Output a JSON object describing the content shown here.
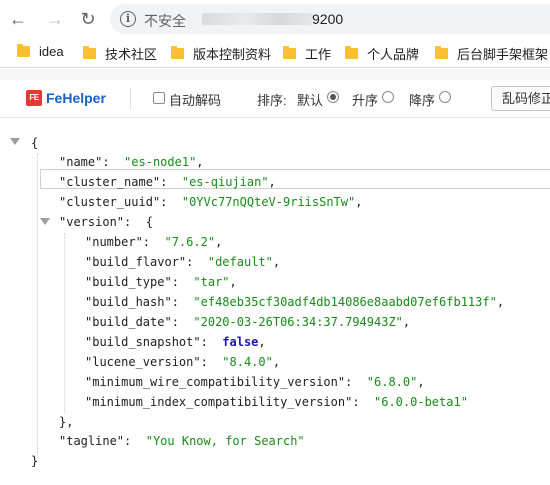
{
  "browser": {
    "back_icon": "back-arrow-icon",
    "forward_icon": "forward-arrow-icon",
    "reload_icon": "reload-icon",
    "security_label": "不安全",
    "url_visible_suffix": "9200"
  },
  "bookmarks": [
    {
      "label": "idea",
      "icon": "folder-icon"
    },
    {
      "label": "技术社区",
      "icon": "folder-icon"
    },
    {
      "label": "版本控制资料",
      "icon": "folder-icon"
    },
    {
      "label": "工作",
      "icon": "folder-icon"
    },
    {
      "label": "个人品牌",
      "icon": "folder-icon"
    },
    {
      "label": "后台脚手架框架",
      "icon": "folder-icon"
    }
  ],
  "fehelper": {
    "logo_mark": "FE",
    "logo_text": "FeHelper",
    "auto_decode_label": "自动解码",
    "auto_decode_checked": false,
    "sort_label": "排序:",
    "sort_options": [
      {
        "label": "默认",
        "selected": true
      },
      {
        "label": "升序",
        "selected": false
      },
      {
        "label": "降序",
        "selected": false
      }
    ],
    "fix_button_label": "乱码修正"
  },
  "json": {
    "open_brace": "{",
    "close_brace": "}",
    "entries": {
      "name": {
        "key": "\"name\"",
        "value": "\"es-node1\""
      },
      "cluster_name": {
        "key": "\"cluster_name\"",
        "value": "\"es-qiujian\""
      },
      "cluster_uuid": {
        "key": "\"cluster_uuid\"",
        "value": "\"0YVc77nQQteV-9riisSnTw\""
      },
      "version": {
        "key": "\"version\"",
        "open": "{",
        "close": "},",
        "fields": [
          {
            "key": "\"number\"",
            "value": "\"7.6.2\"",
            "type": "string"
          },
          {
            "key": "\"build_flavor\"",
            "value": "\"default\"",
            "type": "string"
          },
          {
            "key": "\"build_type\"",
            "value": "\"tar\"",
            "type": "string"
          },
          {
            "key": "\"build_hash\"",
            "value": "\"ef48eb35cf30adf4db14086e8aabd07ef6fb113f\"",
            "type": "string"
          },
          {
            "key": "\"build_date\"",
            "value": "\"2020-03-26T06:34:37.794943Z\"",
            "type": "string"
          },
          {
            "key": "\"build_snapshot\"",
            "value": "false",
            "type": "boolean"
          },
          {
            "key": "\"lucene_version\"",
            "value": "\"8.4.0\"",
            "type": "string"
          },
          {
            "key": "\"minimum_wire_compatibility_version\"",
            "value": "\"6.8.0\"",
            "type": "string"
          },
          {
            "key": "\"minimum_index_compatibility_version\"",
            "value": "\"6.0.0-beta1\"",
            "type": "string"
          }
        ]
      },
      "tagline": {
        "key": "\"tagline\"",
        "value": "\"You Know, for Search\""
      }
    },
    "colon": ":",
    "comma": ","
  }
}
